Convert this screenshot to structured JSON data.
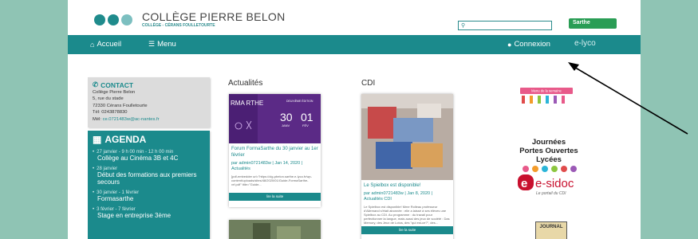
{
  "header": {
    "school_name": "COLLÈGE PIERRE BELON",
    "school_sub": "COLLÈGE - CÉRANS FOULLETOURTE",
    "search_placeholder": "",
    "sarthe_label": "Sarthe"
  },
  "nav": {
    "home_label": "Accueil",
    "menu_label": "Menu",
    "login_label": "Connexion",
    "elyco_label": "e-lyco"
  },
  "contact": {
    "title": "CONTACT",
    "lines": [
      "Collège Pierre Belon",
      "5, rue du stade",
      "72330 Cérans Foulletourte",
      "Tél: 0243878830"
    ],
    "email_prefix": "Mél:",
    "email": "ce.0721483w@ac-nantes.fr"
  },
  "agenda": {
    "title": "AGENDA",
    "items": [
      {
        "date": "27 janvier - 9 h 00 min - 12 h 00 min",
        "text": "Collège au Cinéma 3B et 4C"
      },
      {
        "date": "28 janvier",
        "text": "Début des formations aux premiers secours"
      },
      {
        "date": "30 janvier - 1 février",
        "text": "Formasarthe"
      },
      {
        "date": "3 février - 7 février",
        "text": "Stage en entreprise 3ème"
      }
    ]
  },
  "news": {
    "title": "Actualités",
    "card1": {
      "thumb_left": "RMA RTHE",
      "thumb_edition": "DEUXIÈME ÉDITION",
      "thumb_date_a": "30",
      "thumb_date_b": "01",
      "thumb_month_a": "JANV",
      "thumb_month_b": "FÉV",
      "title": "Forum FormaSarthe du 30 janvier au 1er février",
      "meta": "par admin0721483w | Jan 14, 2020 |",
      "category": "Actualités",
      "excerpt": "[pdf-embedder url=\"https://clg-pbelon.sarthe.e-lyco.fr/wp-content/uploads/sites/48/2020/01/Guide-FormaSarthe-vrf.pdf\" title=\"Guide...",
      "button": "lire la suite"
    }
  },
  "cdi": {
    "title": "CDI",
    "card1": {
      "title": "Le Spielbox est disponible!",
      "meta": "par admin0721483w | Jan 8, 2020 |",
      "category": "Actualités CDI",
      "excerpt": "Le Spielbox est disponible! Mme Rolleau professeur d'Allemand s'était abonnée : elle a laissé à ses élèves une Spielbox au CDI. Au programme : du travail pour perfectionner la langue, mais aussi des jeux de société : Das Memory, des Jeux de Lotos, des \"qui est-ce?\", des...",
      "button": "lire la suite"
    }
  },
  "right": {
    "week_label": "Menu de la semaine",
    "jpo_line1": "Journées",
    "jpo_line2": "Portes Ouvertes",
    "jpo_line3": "Lycées",
    "esidoc": "e-sidoc",
    "esidoc_sub": "Le portail du CDI",
    "journal": "JOURNAL"
  }
}
